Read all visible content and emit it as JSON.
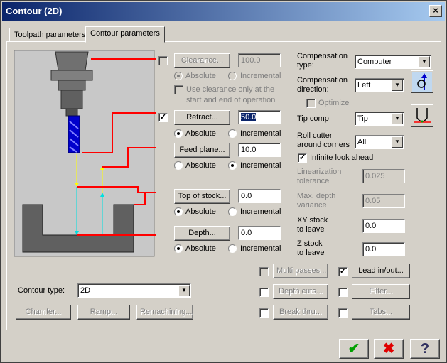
{
  "window": {
    "title": "Contour (2D)",
    "close_glyph": "×"
  },
  "tabs": [
    {
      "label": "Toolpath parameters",
      "active": false
    },
    {
      "label": "Contour parameters",
      "active": true
    }
  ],
  "height_params": {
    "clearance": {
      "label": "Clearance...",
      "value": "100.0",
      "enabled": false,
      "checked": false
    },
    "use_clearance_note_line1": "Use clearance only at the",
    "use_clearance_note_line2": "start and end of operation",
    "retract": {
      "label": "Retract...",
      "value": "50.0",
      "checked": true
    },
    "feed_plane": {
      "label": "Feed plane...",
      "value": "10.0"
    },
    "top_of_stock": {
      "label": "Top of stock...",
      "value": "0.0"
    },
    "depth": {
      "label": "Depth...",
      "value": "0.0"
    },
    "absolute": "Absolute",
    "incremental": "Incremental"
  },
  "right_params": {
    "comp_type_line1": "Compensation",
    "comp_type_line2": "type:",
    "comp_type_value": "Computer",
    "comp_dir_line1": "Compensation",
    "comp_dir_line2": "direction:",
    "comp_dir_value": "Left",
    "optimize": "Optimize",
    "tip_comp": "Tip comp",
    "tip_comp_value": "Tip",
    "roll_line1": "Roll cutter",
    "roll_line2": "around corners",
    "roll_value": "All",
    "infinite_look_ahead": "Infinite look ahead",
    "lin_tol_line1": "Linearization",
    "lin_tol_line2": "tolerance",
    "lin_tol_value": "0.025",
    "max_depth_line1": "Max. depth",
    "max_depth_line2": "variance",
    "max_depth_value": "0.05",
    "xy_stock_line1": "XY stock",
    "xy_stock_line2": "to leave",
    "xy_stock_value": "0.0",
    "z_stock_line1": "Z stock",
    "z_stock_line2": "to leave",
    "z_stock_value": "0.0"
  },
  "contour_type": {
    "label": "Contour type:",
    "value": "2D"
  },
  "options": {
    "multi_passes": "Multi passes...",
    "depth_cuts": "Depth cuts...",
    "break_thru": "Break thru...",
    "lead_in_out": "Lead in/out...",
    "filter": "Filter...",
    "tabs": "Tabs...",
    "chamfer": "Chamfer...",
    "ramp": "Ramp...",
    "remachining": "Remachining..."
  },
  "dialog_buttons": {
    "ok_glyph": "✔",
    "cancel_glyph": "✖",
    "help_glyph": "?"
  },
  "colors": {
    "title_start": "#0a246a",
    "title_end": "#a6caf0",
    "ok": "#00a000",
    "cancel": "#e00000",
    "diagram_red": "#ff0000",
    "diagram_yellow": "#ffff00",
    "diagram_cyan": "#00e0e0",
    "tool_blue": "#0000cc"
  }
}
